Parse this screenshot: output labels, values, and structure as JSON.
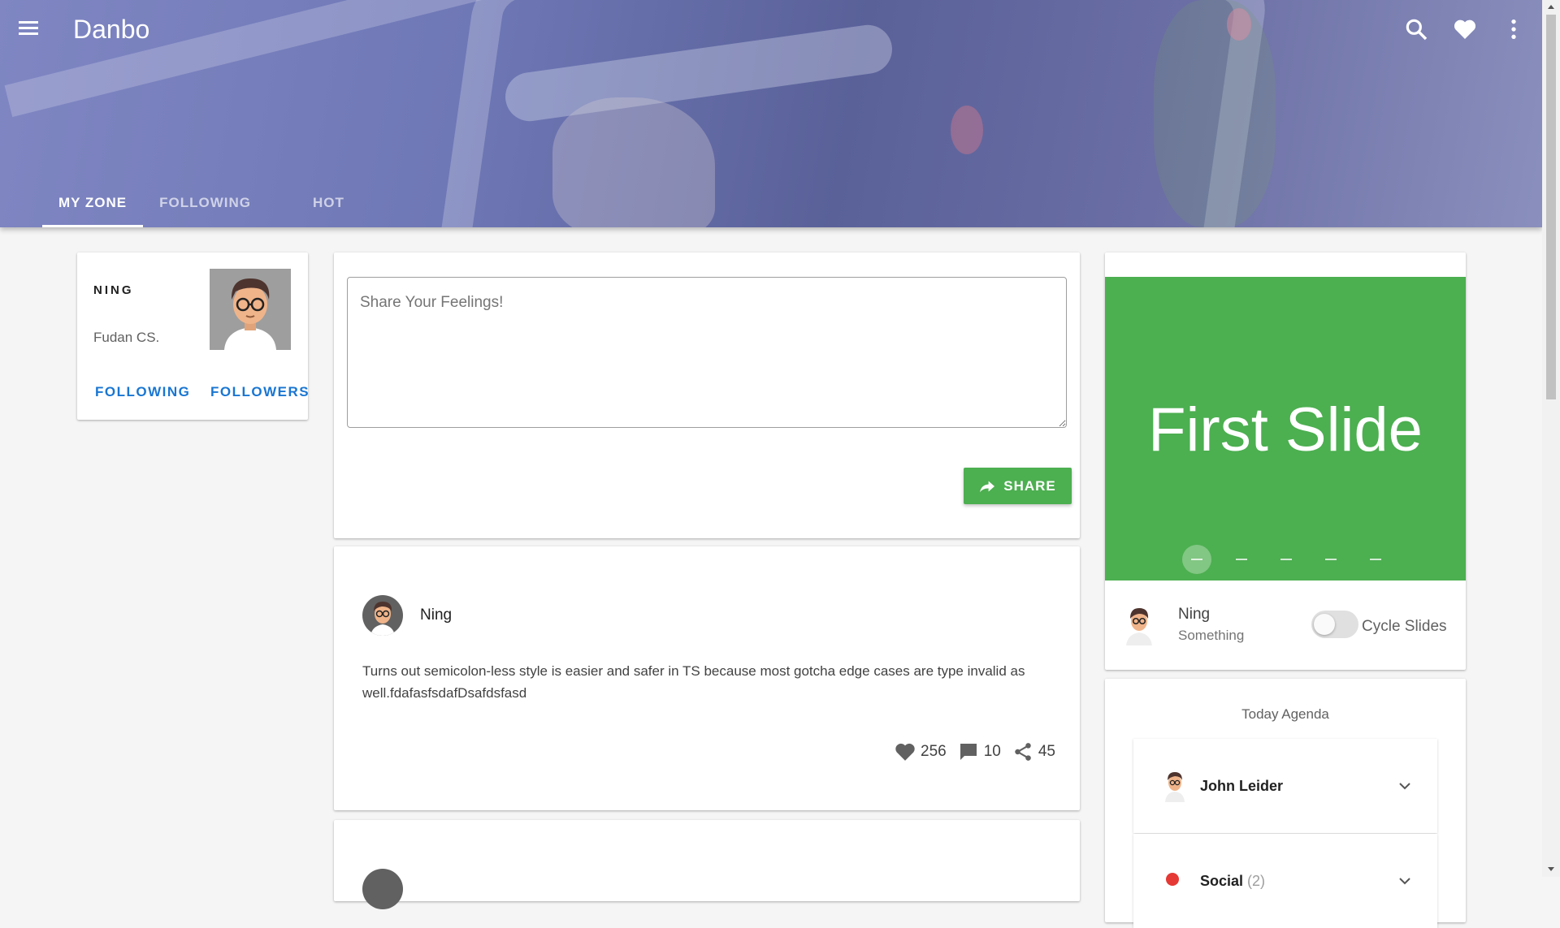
{
  "header": {
    "app_title": "Danbo",
    "tabs": [
      {
        "label": "MY ZONE",
        "active": true
      },
      {
        "label": "FOLLOWING",
        "active": false
      },
      {
        "label": "HOT",
        "active": false
      }
    ],
    "icons": [
      "menu-icon",
      "search-icon",
      "heart-icon",
      "more-vert-icon"
    ]
  },
  "profile": {
    "name": "NING",
    "subtitle": "Fudan CS.",
    "following_label": "FOLLOWING",
    "followers_label": "FOLLOWERS"
  },
  "composer": {
    "placeholder": "Share Your Feelings!",
    "value": "",
    "share_label": "SHARE",
    "accent": "#4caf50"
  },
  "post": {
    "author": "Ning",
    "text": "Turns out semicolon-less style is easier and safer in TS because most gotcha edge cases are type invalid as well.fdafasfsdafDsafdsfasd",
    "likes": "256",
    "comments": "10",
    "shares": "45"
  },
  "carousel": {
    "slide_title": "First Slide",
    "slide_count": 5,
    "active_index": 0,
    "slide_color": "#4caf50",
    "footer_name": "Ning",
    "footer_subtitle": "Something",
    "toggle_label": "Cycle Slides",
    "toggle_on": false
  },
  "agenda": {
    "title": "Today Agenda",
    "items": [
      {
        "name": "John Leider"
      },
      {
        "name": "Social",
        "count": "(2)"
      }
    ]
  }
}
